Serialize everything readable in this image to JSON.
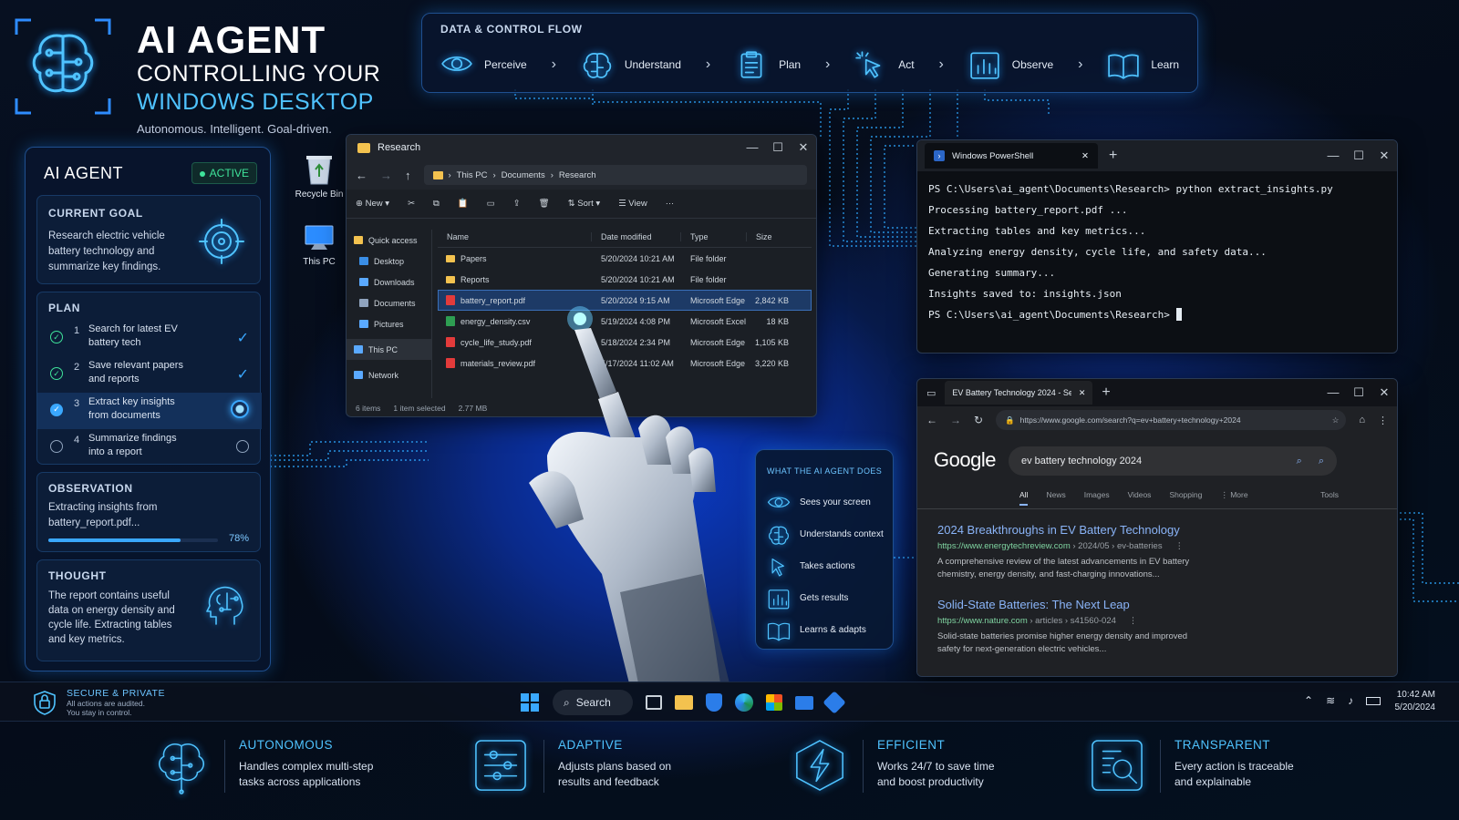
{
  "header": {
    "title": "AI AGENT",
    "line2": "CONTROLLING YOUR",
    "line3": "WINDOWS DESKTOP",
    "tagline": "Autonomous. Intelligent. Goal-driven."
  },
  "flow": {
    "title": "DATA & CONTROL FLOW",
    "steps": [
      {
        "label": "Perceive",
        "icon": "eye-icon"
      },
      {
        "label": "Understand",
        "icon": "brain-icon"
      },
      {
        "label": "Plan",
        "icon": "clipboard-icon"
      },
      {
        "label": "Act",
        "icon": "cursor-click-icon"
      },
      {
        "label": "Observe",
        "icon": "bar-chart-icon"
      },
      {
        "label": "Learn",
        "icon": "book-icon"
      }
    ]
  },
  "agent": {
    "title": "AI AGENT",
    "status": "ACTIVE",
    "goal": {
      "caption": "CURRENT GOAL",
      "text": "Research electric vehicle battery technology and summarize key findings."
    },
    "plan": {
      "caption": "PLAN",
      "steps": [
        {
          "num": "1",
          "l1": "Search for latest EV",
          "l2": "battery tech",
          "state": "done"
        },
        {
          "num": "2",
          "l1": "Save relevant papers",
          "l2": "and reports",
          "state": "done"
        },
        {
          "num": "3",
          "l1": "Extract key insights",
          "l2": "from documents",
          "state": "active"
        },
        {
          "num": "4",
          "l1": "Summarize findings",
          "l2": "into a report",
          "state": "pending"
        }
      ]
    },
    "observation": {
      "caption": "OBSERVATION",
      "l1": "Extracting insights from",
      "l2": "battery_report.pdf...",
      "progress": 0.78,
      "progress_label": "78%"
    },
    "thought": {
      "caption": "THOUGHT",
      "text": "The report contains useful data on energy density and cycle life. Extracting tables and key metrics."
    }
  },
  "desktop": {
    "recycle": "Recycle Bin",
    "thispc": "This PC"
  },
  "explorer": {
    "title": "Research",
    "path": [
      "This PC",
      "Documents",
      "Research"
    ],
    "toolbar": {
      "new": "New",
      "sort": "Sort",
      "view": "View"
    },
    "sidebar": [
      "Quick access",
      "Desktop",
      "Downloads",
      "Documents",
      "Pictures",
      "This PC",
      "Network"
    ],
    "columns": [
      "Name",
      "Date modified",
      "Type",
      "Size"
    ],
    "rows": [
      {
        "name": "Papers",
        "date": "5/20/2024 10:21 AM",
        "type": "File folder",
        "size": "",
        "kind": "folder"
      },
      {
        "name": "Reports",
        "date": "5/20/2024 10:21 AM",
        "type": "File folder",
        "size": "",
        "kind": "folder"
      },
      {
        "name": "battery_report.pdf",
        "date": "5/20/2024 9:15 AM",
        "type": "Microsoft Edge P...",
        "size": "2,842 KB",
        "kind": "pdf",
        "selected": true
      },
      {
        "name": "energy_density.csv",
        "date": "5/19/2024 4:08 PM",
        "type": "Microsoft Excel C...",
        "size": "18 KB",
        "kind": "csv"
      },
      {
        "name": "cycle_life_study.pdf",
        "date": "5/18/2024 2:34 PM",
        "type": "Microsoft Edge P...",
        "size": "1,105 KB",
        "kind": "pdf"
      },
      {
        "name": "materials_review.pdf",
        "date": "5/17/2024 11:02 AM",
        "type": "Microsoft Edge P...",
        "size": "3,220 KB",
        "kind": "pdf"
      }
    ],
    "status": {
      "items": "6 items",
      "selected": "1 item selected",
      "size": "2.77 MB"
    }
  },
  "powershell": {
    "tab": "Windows PowerShell",
    "lines": [
      "PS C:\\Users\\ai_agent\\Documents\\Research> python extract_insights.py",
      "Processing battery_report.pdf ...",
      "Extracting tables and key metrics...",
      "Analyzing energy density, cycle life, and safety data...",
      "Generating summary...",
      "Insights saved to: insights.json",
      "PS C:\\Users\\ai_agent\\Documents\\Research> "
    ]
  },
  "browser": {
    "tab": "EV Battery Technology 2024 - Sea",
    "url": "https://www.google.com/search?q=ev+battery+technology+2024",
    "logo": "Google",
    "query": "ev battery technology 2024",
    "tabs": [
      "All",
      "News",
      "Images",
      "Videos",
      "Shopping",
      "⋮ More"
    ],
    "tools": "Tools",
    "results": [
      {
        "title": "2024 Breakthroughs in EV Battery Technology",
        "site": "https://www.energytechreview.com",
        "crumb": " › 2024/05 › ev-batteries",
        "l1": "A comprehensive review of the latest advancements in EV battery",
        "l2": "chemistry, energy density, and fast-charging innovations..."
      },
      {
        "title": "Solid-State Batteries: The Next Leap",
        "site": "https://www.nature.com",
        "crumb": " › articles › s41560-024",
        "l1": "Solid-state batteries promise higher energy density and improved",
        "l2": "safety for next-generation electric vehicles..."
      }
    ]
  },
  "does": {
    "title": "WHAT THE AI AGENT DOES",
    "items": [
      {
        "label": "Sees your screen",
        "icon": "eye-icon"
      },
      {
        "label": "Understands context",
        "icon": "brain-icon"
      },
      {
        "label": "Takes actions",
        "icon": "cursor-icon"
      },
      {
        "label": "Gets results",
        "icon": "bar-chart-icon"
      },
      {
        "label": "Learns & adapts",
        "icon": "book-icon"
      }
    ]
  },
  "taskbar": {
    "secure_title": "SECURE & PRIVATE",
    "secure_l1": "All actions are audited.",
    "secure_l2": "You stay in control.",
    "search": "Search",
    "time": "10:42 AM",
    "date": "5/20/2024"
  },
  "features": [
    {
      "title": "AUTONOMOUS",
      "l1": "Handles complex multi-step",
      "l2": "tasks across applications",
      "icon": "brain-circuit-icon"
    },
    {
      "title": "ADAPTIVE",
      "l1": "Adjusts plans based on",
      "l2": "results and feedback",
      "icon": "sliders-icon"
    },
    {
      "title": "EFFICIENT",
      "l1": "Works 24/7 to save time",
      "l2": "and boost productivity",
      "icon": "lightning-icon"
    },
    {
      "title": "TRANSPARENT",
      "l1": "Every action is traceable",
      "l2": "and explainable",
      "icon": "document-search-icon"
    }
  ],
  "colors": {
    "accent": "#4fc3ff",
    "bg": "#050c19",
    "panel": "#081630"
  }
}
